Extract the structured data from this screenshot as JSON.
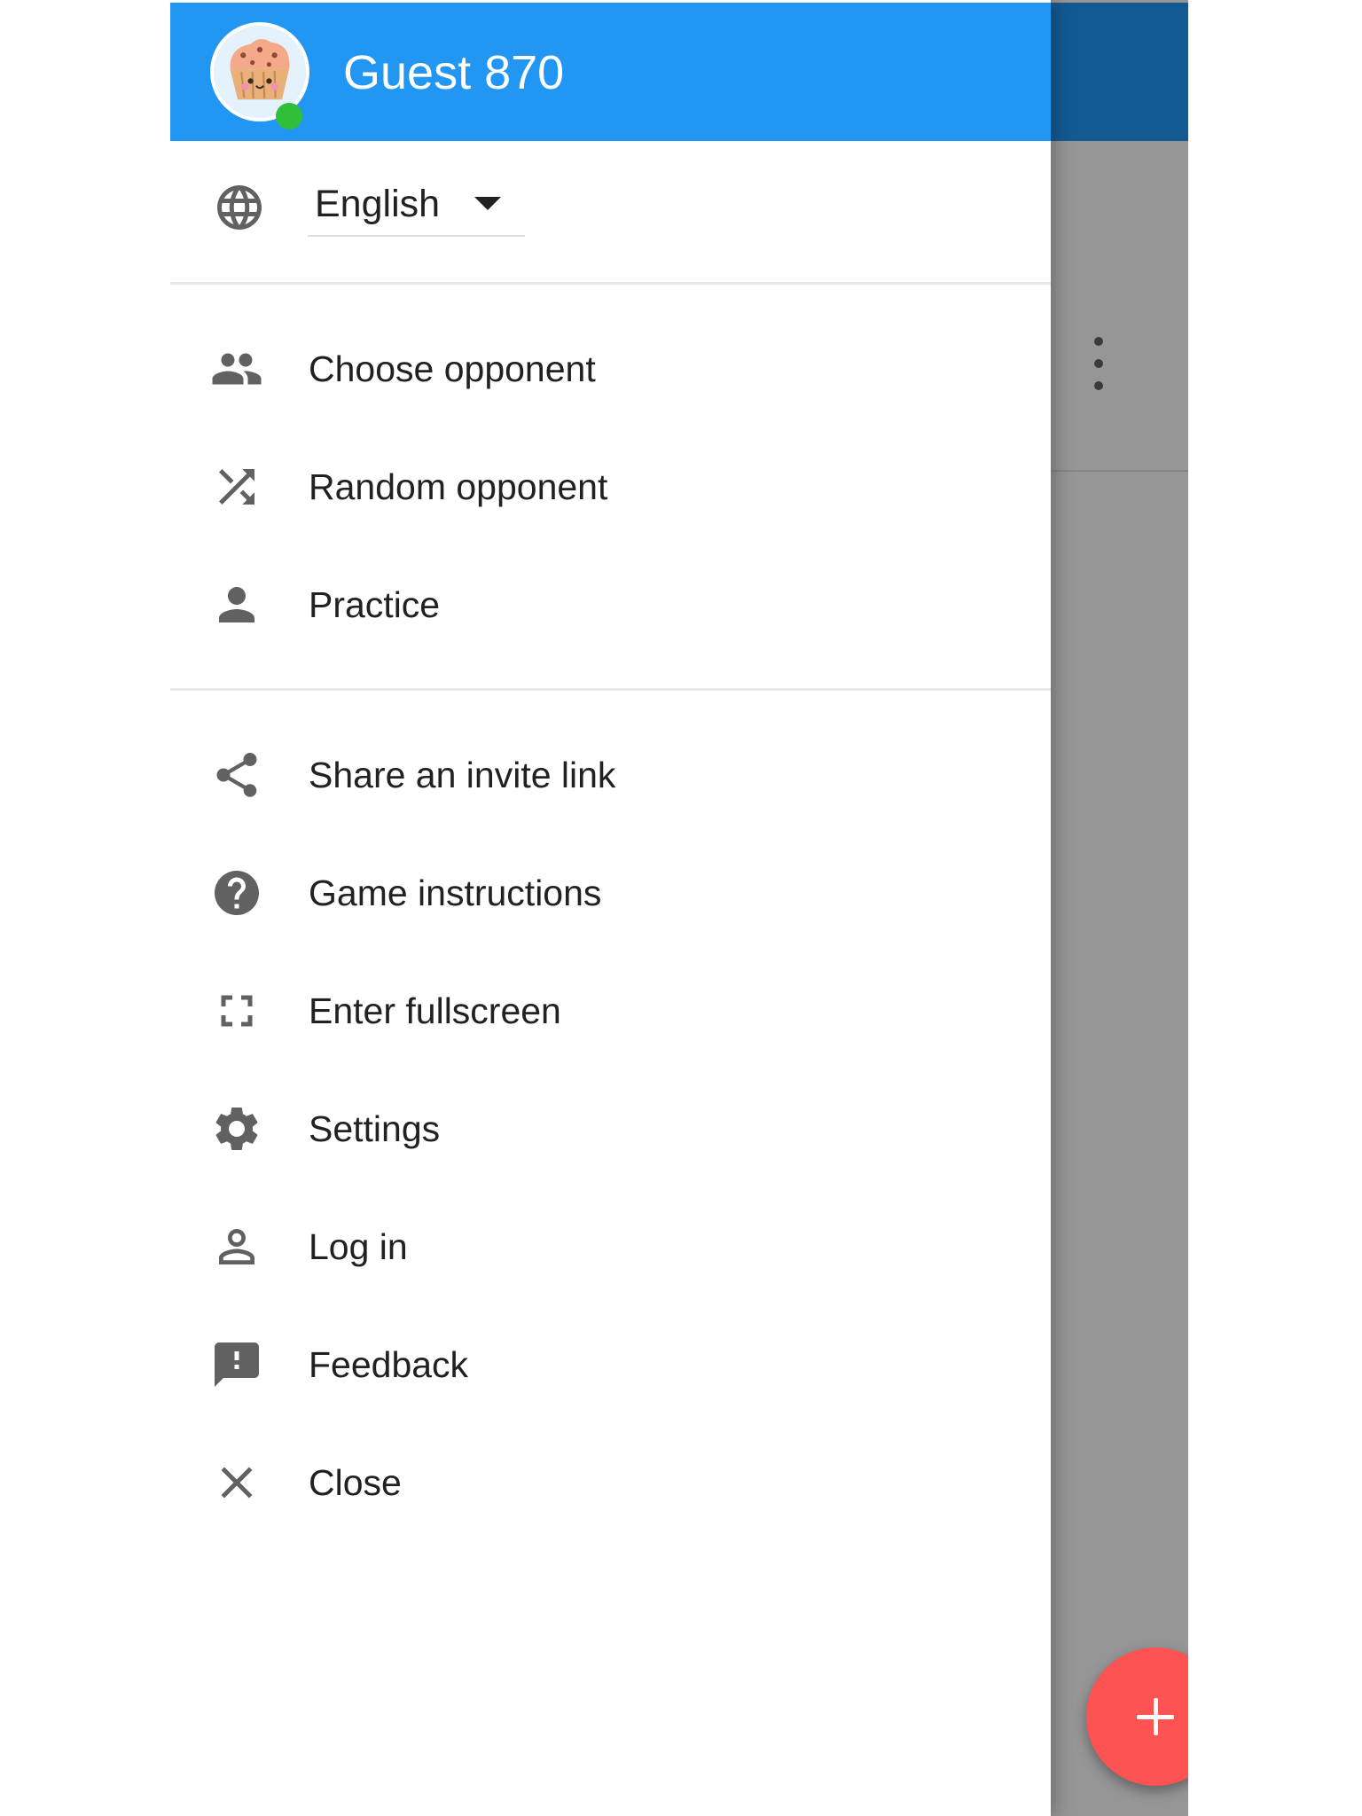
{
  "user": {
    "name": "Guest 870",
    "online": true,
    "avatar_icon": "muffin-avatar"
  },
  "language": {
    "icon": "globe-icon",
    "selected": "English"
  },
  "menu": {
    "play": [
      {
        "id": "choose-opponent",
        "icon": "people-icon",
        "label": "Choose opponent"
      },
      {
        "id": "random-opponent",
        "icon": "shuffle-icon",
        "label": "Random opponent"
      },
      {
        "id": "practice",
        "icon": "person-icon",
        "label": "Practice"
      }
    ],
    "general": [
      {
        "id": "share-invite-link",
        "icon": "share-icon",
        "label": "Share an invite link"
      },
      {
        "id": "game-instructions",
        "icon": "help-icon",
        "label": "Game instructions"
      },
      {
        "id": "enter-fullscreen",
        "icon": "fullscreen-icon",
        "label": "Enter fullscreen"
      },
      {
        "id": "settings",
        "icon": "gear-icon",
        "label": "Settings"
      },
      {
        "id": "log-in",
        "icon": "person-outline-icon",
        "label": "Log in"
      },
      {
        "id": "feedback",
        "icon": "feedback-icon",
        "label": "Feedback"
      },
      {
        "id": "close",
        "icon": "close-icon",
        "label": "Close"
      }
    ]
  },
  "background_app": {
    "more_menu_icon": "more-vertical-icon",
    "fab_icon": "plus-icon"
  },
  "colors": {
    "primary": "#2196f3",
    "accent": "#ff5252",
    "online": "#2fbf3a",
    "icon": "#616161"
  }
}
